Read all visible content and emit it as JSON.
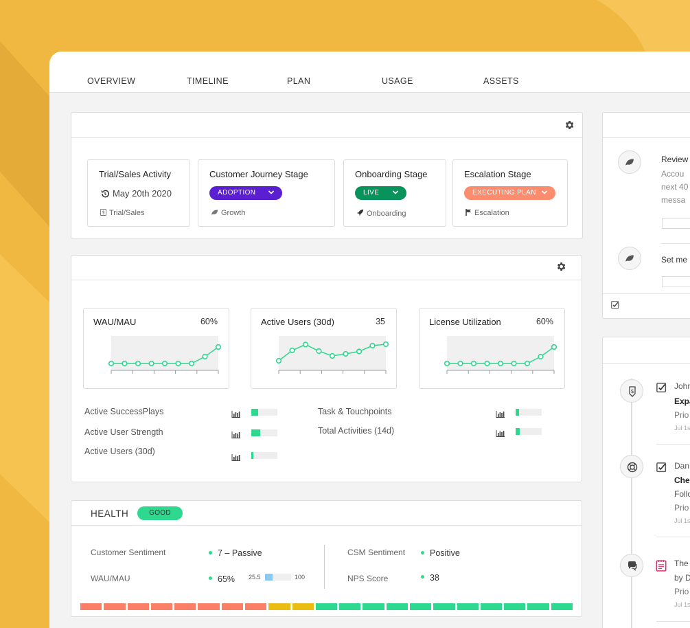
{
  "tabs": [
    "OVERVIEW",
    "TIMELINE",
    "PLAN",
    "USAGE",
    "ASSETS"
  ],
  "stages": [
    {
      "title": "Trial/Sales Activity",
      "date": "May 20th 2020",
      "footer": "Trial/Sales",
      "footer_icon": "dollar-doc-icon"
    },
    {
      "title": "Customer Journey Stage",
      "pill": "ADOPTION",
      "pill_color": "#5a1fd1",
      "footer": "Growth",
      "footer_icon": "leaf-icon"
    },
    {
      "title": "Onboarding Stage",
      "pill": "LIVE",
      "pill_color": "#07935a",
      "footer": "Onboarding",
      "footer_icon": "rocket-icon"
    },
    {
      "title": "Escalation Stage",
      "pill": "EXECUTING PLAN",
      "pill_color": "#fb8c6d",
      "footer": "Escalation",
      "footer_icon": "flag-icon"
    }
  ],
  "chart_data": [
    {
      "type": "line",
      "title": "WAU/MAU",
      "value_label": "60%",
      "values": [
        0.1,
        0.1,
        0.1,
        0.1,
        0.1,
        0.1,
        0.1,
        0.3,
        0.58
      ]
    },
    {
      "type": "line",
      "title": "Active Users (30d)",
      "value_label": "35",
      "values": [
        0.18,
        0.48,
        0.65,
        0.46,
        0.32,
        0.38,
        0.45,
        0.62,
        0.66
      ]
    },
    {
      "type": "line",
      "title": "License Utilization",
      "value_label": "60%",
      "values": [
        0.1,
        0.1,
        0.1,
        0.1,
        0.1,
        0.1,
        0.1,
        0.3,
        0.58
      ]
    }
  ],
  "metrics_left": [
    {
      "label": "Active SuccessPlays",
      "fill": 0.26
    },
    {
      "label": "Active User Strength",
      "fill": 0.34
    },
    {
      "label": "Active Users (30d)",
      "fill": 0.08
    }
  ],
  "metrics_right": [
    {
      "label": "Task & Touchpoints",
      "fill": 0.12
    },
    {
      "label": "Total Activities (14d)",
      "fill": 0.16
    }
  ],
  "health": {
    "title": "HEALTH",
    "badge": "GOOD",
    "customer_sentiment_label": "Customer Sentiment",
    "customer_sentiment_value": "7 – Passive",
    "wau_label": "WAU/MAU",
    "wau_value": "65%",
    "wau_min": "25.5",
    "wau_max": "100",
    "wau_fill": 0.3,
    "csm_label": "CSM Sentiment",
    "csm_value": "Positive",
    "nps_label": "NPS Score",
    "nps_value": "38",
    "scale_colors": [
      "#fa7f66",
      "#fa7f66",
      "#fa7f66",
      "#fa7f66",
      "#fa7f66",
      "#fa7f66",
      "#fa7f66",
      "#fa7f66",
      "#e9bd13",
      "#e9bd13",
      "#2ed88e",
      "#2ed88e",
      "#2ed88e",
      "#2ed88e",
      "#2ed88e",
      "#2ed88e",
      "#2ed88e",
      "#2ed88e",
      "#2ed88e",
      "#2ed88e",
      "#2ed88e"
    ]
  },
  "right_panel": {
    "items": [
      {
        "title": "Review",
        "line1": "Accou",
        "line2": "next 40",
        "line3": "messa"
      },
      {
        "title": "Set me"
      }
    ]
  },
  "timeline": [
    {
      "icon": "dollar-icon",
      "who": "John",
      "title": "Expa",
      "status": "Prio",
      "date": "Jul 1s"
    },
    {
      "icon": "lifebuoy-icon",
      "who": "Dan",
      "title": "Che",
      "line": "Follo",
      "status": "Prio",
      "date": "Jul 1s"
    },
    {
      "icon": "chat-icon",
      "who": "The",
      "line": "by D",
      "status": "Prio",
      "date": "Jul 1s"
    }
  ],
  "colors": {
    "accent_green": "#2ed88e",
    "bar_blue": "#8cc8ef",
    "bg_yellow": "#f0b840"
  }
}
